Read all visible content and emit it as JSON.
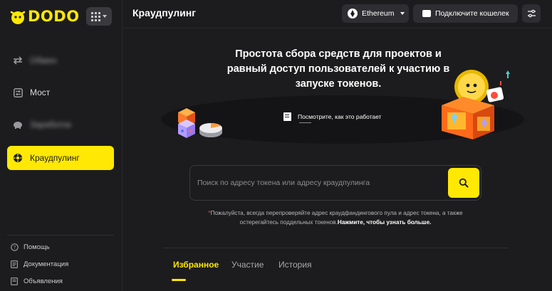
{
  "brand": {
    "logo_text": "DODO",
    "accent_color": "#ffe804"
  },
  "sidebar": {
    "items": [
      {
        "label": "Обмен",
        "icon": "swap-icon",
        "blurred": true
      },
      {
        "label": "Мост",
        "icon": "bridge-icon",
        "blurred": false
      },
      {
        "label": "Заработок",
        "icon": "piggy-bank-icon",
        "blurred": true
      },
      {
        "label": "Краудпулинг",
        "icon": "crowdpooling-icon",
        "active": true
      }
    ],
    "footer": [
      {
        "label": "Помощь",
        "icon": "help-icon"
      },
      {
        "label": "Документация",
        "icon": "docs-icon"
      },
      {
        "label": "Объявления",
        "icon": "announcement-icon"
      }
    ]
  },
  "header": {
    "title": "Краудпулинг",
    "chain": "Ethereum",
    "connect_wallet": "Подключите кошелек"
  },
  "hero": {
    "title": "Простота сбора средств для проектов и равный доступ пользователей к участию в запуске токенов.",
    "how_it_works": "Посмотрите, как это работает"
  },
  "search": {
    "placeholder": "Поиск по адресу токена или адресу краудпулинга",
    "value": ""
  },
  "warning": {
    "star": "*",
    "text": "Пожалуйста, всегда перепроверяйте адрес краудфандингового пула и адрес токена, а также остерегайтесь поддельных токенов.",
    "link": "Нажмите, чтобы узнать больше."
  },
  "tabs": [
    {
      "label": "Избранное",
      "active": true
    },
    {
      "label": "Участие",
      "active": false
    },
    {
      "label": "История",
      "active": false
    }
  ]
}
